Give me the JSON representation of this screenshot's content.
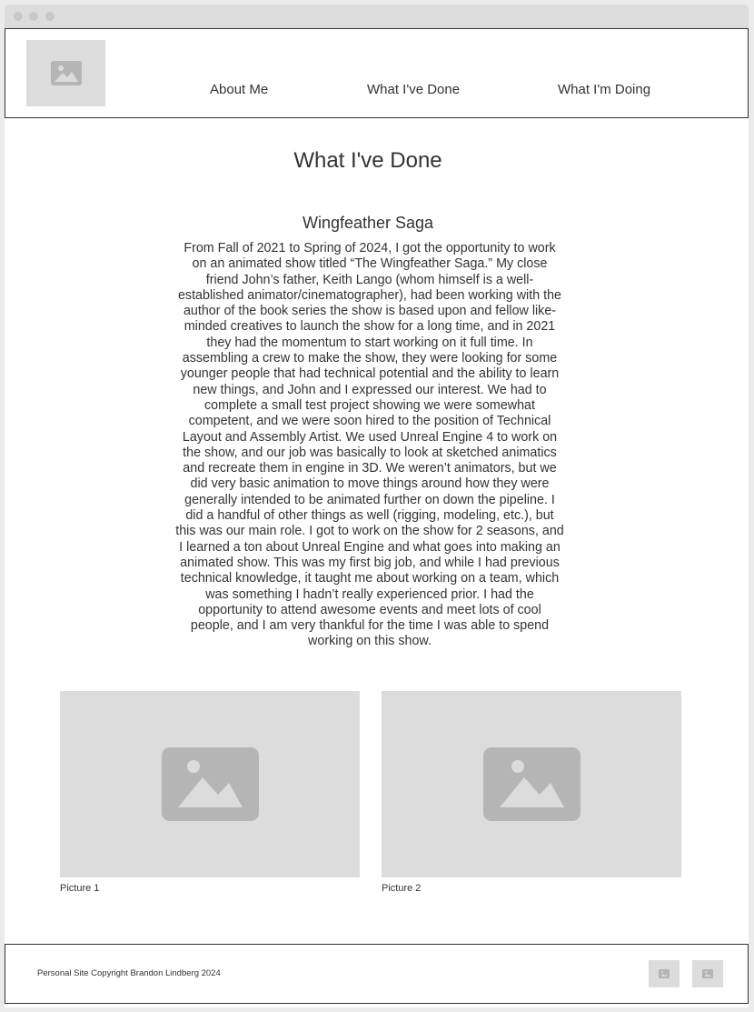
{
  "nav": {
    "items": [
      {
        "label": "About Me"
      },
      {
        "label": "What I've Done"
      },
      {
        "label": "What I'm Doing"
      }
    ],
    "logo_icon": "image-placeholder-icon"
  },
  "main": {
    "page_title": "What I've Done",
    "section": {
      "title": "Wingfeather Saga",
      "body": "From Fall of 2021 to Spring of 2024, I got the opportunity to work on an animated show titled “The Wingfeather Saga.” My close friend John’s father, Keith Lango (whom himself is a well-established animator/cinematographer), had been working with the author of the book series the show is based upon and fellow like-minded creatives to launch the show for a long time, and in 2021 they had the momentum to start working on it full time. In assembling a crew to make the show, they were looking for some younger people that had technical potential and the ability to learn new things, and John and I expressed our interest. We had to complete a small test project showing we were somewhat competent, and we were soon hired to the position of Technical Layout and Assembly Artist. We used Unreal Engine 4 to work on the show, and our job was basically to look at sketched animatics and recreate them in engine in 3D. We weren’t animators, but we did very basic animation to move things around how they were generally intended to be animated further on down the pipeline. I did a handful of other things as well (rigging, modeling, etc.), but this was our main role. I got to work on the show for 2 seasons, and I learned a ton about Unreal Engine and what goes into making an animated show. This was my first big job, and while I had previous technical knowledge, it taught me about working on a team, which was something I hadn’t really experienced prior. I had the opportunity to attend awesome events and meet lots of cool people, and I am very thankful for the time I was able to spend working on this show."
    },
    "pictures": [
      {
        "caption": "Picture 1",
        "icon": "image-placeholder-icon"
      },
      {
        "caption": "Picture 2",
        "icon": "image-placeholder-icon"
      }
    ]
  },
  "footer": {
    "copyright": "Personal Site Copyright Brandon Lindberg 2024",
    "social_icons": [
      "image-placeholder-icon",
      "image-placeholder-icon"
    ]
  },
  "colors": {
    "placeholder_bg": "#dcdcdc",
    "placeholder_icon": "#b5b5b5",
    "text": "#333333",
    "border": "#333333",
    "window_chrome": "#dcdcdc"
  }
}
